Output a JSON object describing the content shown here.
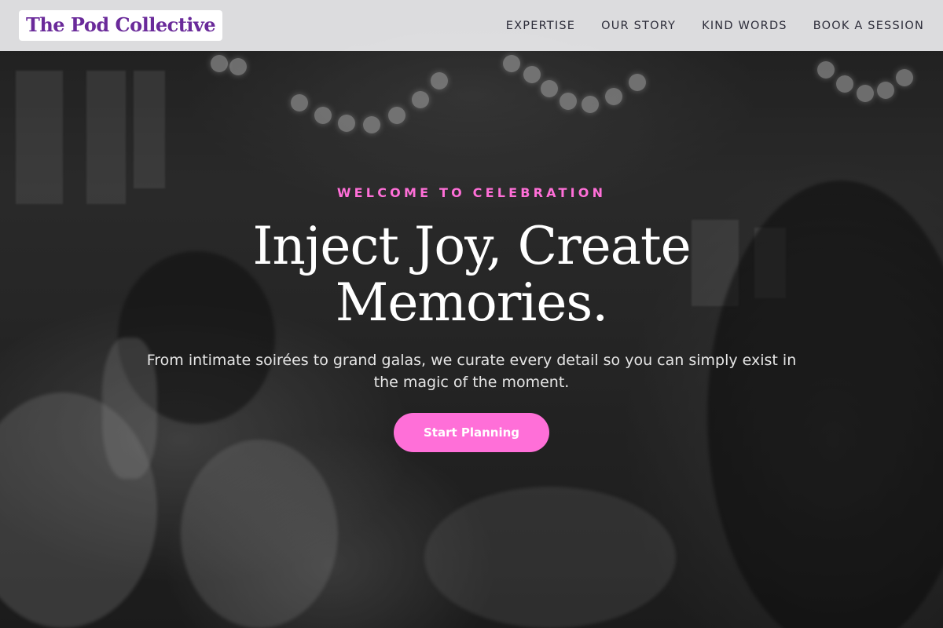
{
  "brand": {
    "logo_text": "The Pod Collective",
    "logo_color": "#6a2a9a"
  },
  "nav": {
    "items": [
      {
        "label": "EXPERTISE"
      },
      {
        "label": "OUR STORY"
      },
      {
        "label": "KIND WORDS"
      },
      {
        "label": "BOOK A SESSION"
      }
    ]
  },
  "hero": {
    "eyebrow": "WELCOME TO CELEBRATION",
    "headline_line1": "Inject Joy, Create",
    "headline_line2": "Memories.",
    "subtext": "From intimate soirées to grand galas, we curate every detail so you can simply exist in the magic of the moment.",
    "cta_label": "Start Planning",
    "background_image": "grayscale photo of a dinner celebration with guests raising champagne glasses and string lights",
    "accent_color": "#ff6fd8"
  }
}
